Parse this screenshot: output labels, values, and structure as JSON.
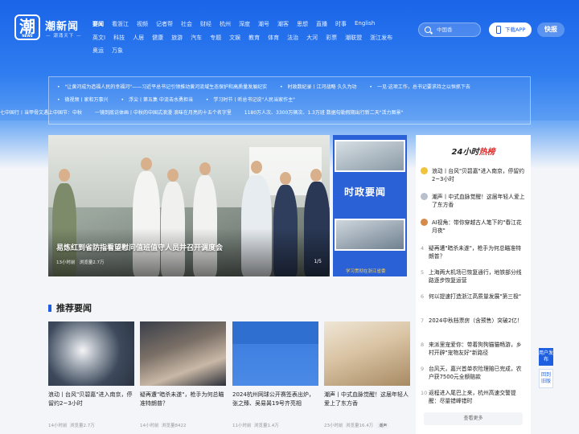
{
  "header": {
    "logo_char": "潮",
    "logo_sub": "NEWS",
    "logo_name": "潮新闻",
    "slogan": "— 潮涌天下 —",
    "nav_row1": [
      "要闻",
      "看浙江",
      "视频",
      "记者帮",
      "社会",
      "财经",
      "杭州",
      "深度",
      "潮号",
      "潮客",
      "思想",
      "直播",
      "时事",
      "English"
    ],
    "nav_row2": [
      "英文Ⅰ",
      "科技",
      "人居",
      "健康",
      "旅游",
      "汽车",
      "专题",
      "文娱",
      "教育",
      "体育",
      "法治",
      "大河",
      "彩票",
      "潮联盟",
      "浙江发布"
    ],
    "nav_row3": [
      "奥运",
      "万象"
    ],
    "search_placeholder": "中国香",
    "app_button": "下载APP",
    "report_button": "快报"
  },
  "ticker": {
    "row1": [
      "\"让黄河成为造福人民的幸福河\"——习近平总书记引领推动黄河流域生态保护和高质量发展纪实",
      "时政数纪录丨江河战略 久久为功",
      "一见·这项工作，总书记要求持之以恒抓下去"
    ],
    "row2": [
      "微视频丨家和万事兴",
      "浮尖丨第五集 中流击水勇担当",
      "学习时节丨听总书记说\"人民当家作主\""
    ],
    "row3": [
      "七中国行丨当甲骨文遇上中国节：中秋",
      "一镜到底访体画丨中秋的中国式浪漫 浪味在月亮的十五个名字里",
      "1180万人次、3300万辆次、1.3万班 数据勾勒假期出行新二天\"活力图景\""
    ]
  },
  "slider": {
    "caption": "易炼红到省防指看望慰问值班值守人员并召开调度会",
    "time": "13小时前",
    "views": "浏览量2.7万",
    "count": "1/5"
  },
  "side_panel": {
    "title": "时政要闻",
    "footer": "学习贯彻在浙江省委"
  },
  "hot": {
    "title_prefix": "24小时",
    "title_em": "热榜",
    "items": [
      {
        "num": "1",
        "text": "浪动丨台风\"贝碧嘉\"进入南京，停留约2~3小时"
      },
      {
        "num": "2",
        "text": "潮声丨中式血脉觉醒！这届年轻人爱上了东方香"
      },
      {
        "num": "3",
        "text": "AI视角：带你穿越古人笔下的\"春江花月夜\""
      },
      {
        "num": "4",
        "text": "疑再遭\"暗杀未遂\"，枪手为何总瞄准特朗普？"
      },
      {
        "num": "5",
        "text": "上海两大机场已恢复通行，地铁部分线路逐步恢复运营"
      },
      {
        "num": "6",
        "text": "何以提速打造浙江高质量发展\"第三极\""
      },
      {
        "num": "7",
        "text": "2024中秋档票房（含预售）突破2亿！"
      },
      {
        "num": "8",
        "text": "来派里宠爱你：带着狗狗猫猫畅游，乡村开辟\"宠物友好\"新路径"
      },
      {
        "num": "9",
        "text": "台风天，嘉兴首单农险理赔已完成，农户获7500元全额赔款"
      },
      {
        "num": "10",
        "text": "返程进入尾巴上来，杭州高速交警提醒：尽量错峰错时"
      }
    ],
    "more": "查看更多"
  },
  "recommend": {
    "title": "推荐要闻",
    "cards": [
      {
        "text": "浪动丨台风\"贝碧嘉\"进入南京，停留约2~3小时",
        "time": "14小时前",
        "views": "浏览量2.7万",
        "tag": ""
      },
      {
        "text": "疑再遭\"暗杀未遂\"，枪手为何总瞄准特朗普？",
        "time": "14小时前",
        "views": "浏览量8422",
        "tag": ""
      },
      {
        "text": "2024杭州网球公开赛签表出炉，张之臻、吴易昺19号齐亮相",
        "time": "11小时前",
        "views": "浏览量1.4万",
        "tag": ""
      },
      {
        "text": "潮声丨中式血脉觉醒！这届年轻人爱上了东方香",
        "time": "23小时前",
        "views": "浏览量16.4万",
        "tag": "潮声"
      }
    ]
  },
  "float": {
    "btn1": "用户发布",
    "btn2": "回到旧版"
  }
}
